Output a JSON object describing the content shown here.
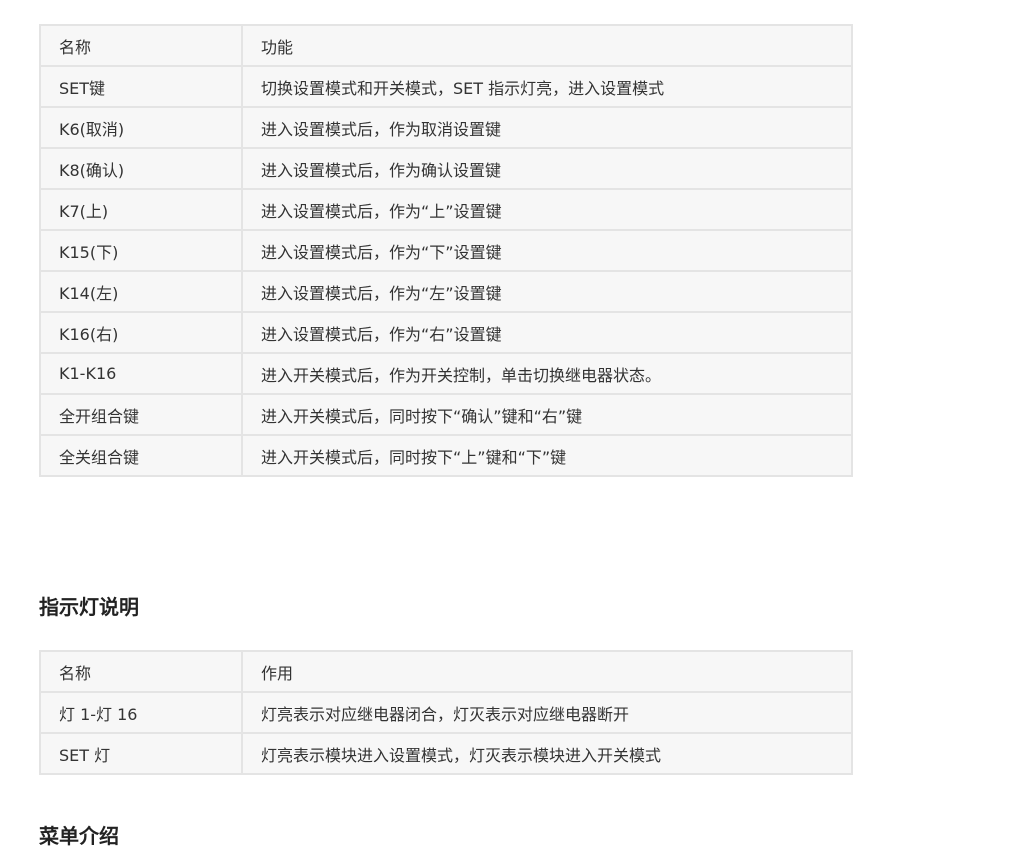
{
  "keys_table": {
    "header": [
      "名称",
      "功能"
    ],
    "rows": [
      [
        "SET键",
        "切换设置模式和开关模式，SET 指示灯亮，进入设置模式"
      ],
      [
        "K6(取消)",
        "进入设置模式后，作为取消设置键"
      ],
      [
        "K8(确认)",
        "进入设置模式后，作为确认设置键"
      ],
      [
        "K7(上)",
        "进入设置模式后，作为“上”设置键"
      ],
      [
        "K15(下)",
        "进入设置模式后，作为“下”设置键"
      ],
      [
        "K14(左)",
        "进入设置模式后，作为“左”设置键"
      ],
      [
        "K16(右)",
        "进入设置模式后，作为“右”设置键"
      ],
      [
        "K1-K16",
        "进入开关模式后，作为开关控制，单击切换继电器状态。"
      ],
      [
        "全开组合键",
        "进入开关模式后，同时按下“确认”键和“右”键"
      ],
      [
        "全关组合键",
        "进入开关模式后，同时按下“上”键和“下”键"
      ]
    ]
  },
  "lights_section": {
    "heading": "指示灯说明",
    "header": [
      "名称",
      "作用"
    ],
    "rows": [
      [
        "灯 1-灯 16",
        "灯亮表示对应继电器闭合，灯灭表示对应继电器断开"
      ],
      [
        "SET 灯",
        "灯亮表示模块进入设置模式，灯灭表示模块进入开关模式"
      ]
    ]
  },
  "menu_section": {
    "heading": "菜单介绍"
  }
}
